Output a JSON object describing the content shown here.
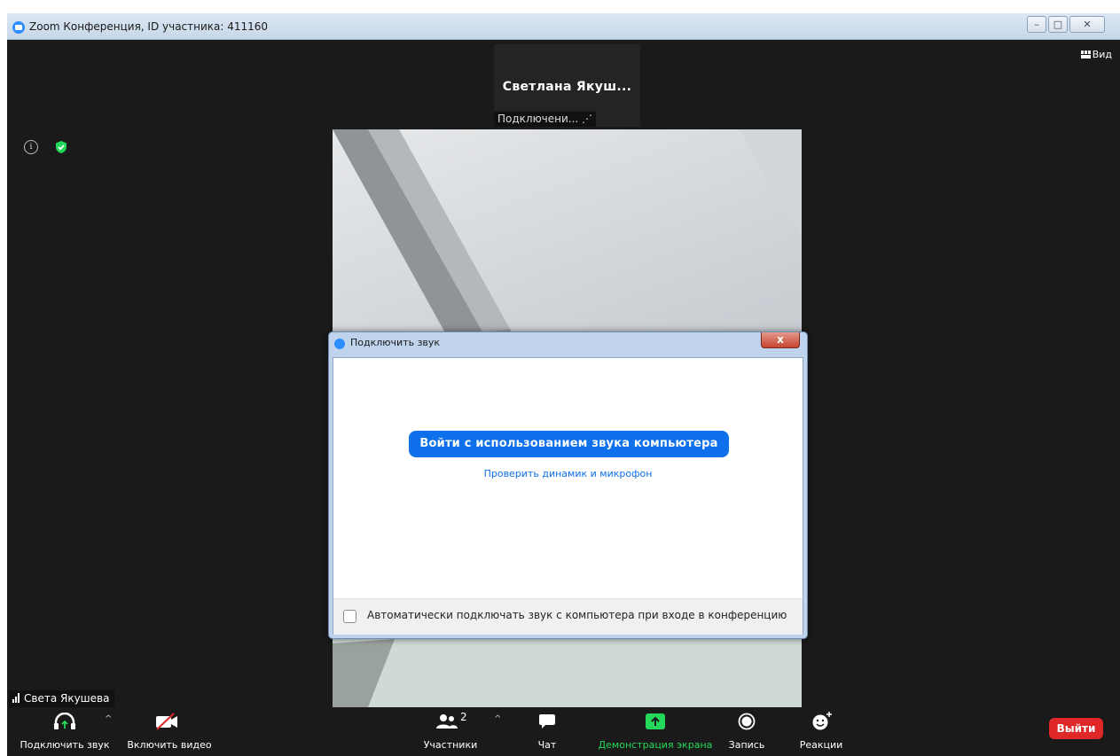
{
  "window": {
    "title": "Zoom Конференция, ID участника: 411160",
    "controls": {
      "minimize": "–",
      "maximize": "□",
      "close": "✕"
    }
  },
  "meeting": {
    "view_label": "Вид",
    "remote_participant": {
      "name": "Светлана Якуш...",
      "status": "Подключени... ⋰"
    },
    "self_name": "Света Якушева"
  },
  "dialog": {
    "title": "Подключить звук",
    "close_label": "x",
    "join_button": "Войти с использованием звука компьютера",
    "test_link": "Проверить динамик и микрофон",
    "auto_connect_label": "Автоматически подключать звук с компьютера при входе в конференцию",
    "auto_connect_checked": false
  },
  "toolbar": {
    "join_audio": "Подключить звук",
    "start_video": "Включить видео",
    "participants": "Участники",
    "participants_count": "2",
    "chat": "Чат",
    "share_screen": "Демонстрация экрана",
    "record": "Запись",
    "reactions": "Реакции",
    "leave": "Выйти",
    "caret": "^"
  },
  "colors": {
    "zoom_blue": "#0e71eb",
    "share_green": "#23d959",
    "leave_red": "#e02828",
    "background": "#1a1a1a"
  }
}
